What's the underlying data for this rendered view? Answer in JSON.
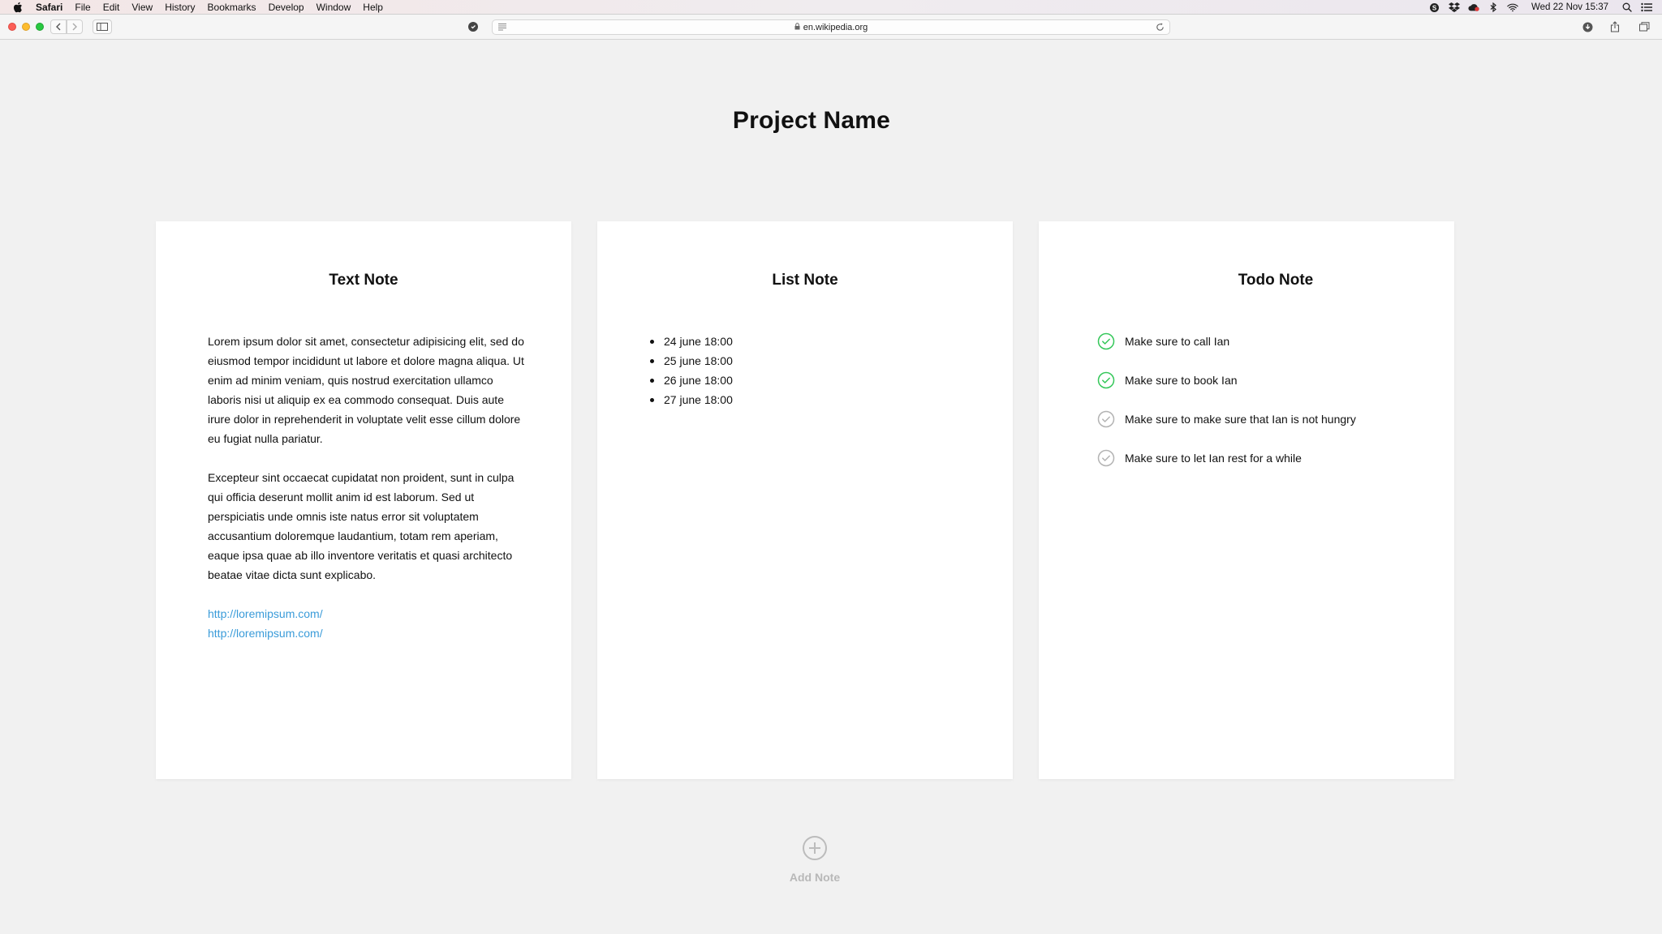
{
  "menubar": {
    "app_name": "Safari",
    "items": [
      "File",
      "Edit",
      "View",
      "History",
      "Bookmarks",
      "Develop",
      "Window",
      "Help"
    ],
    "clock": "Wed 22 Nov  15:37"
  },
  "browser": {
    "url": "en.wikipedia.org"
  },
  "page": {
    "title": "Project Name",
    "add_note_label": "Add Note"
  },
  "text_note": {
    "title": "Text Note",
    "paragraphs": [
      "Lorem ipsum dolor sit amet, consectetur adipisicing elit, sed do eiusmod tempor incididunt ut labore et dolore magna aliqua. Ut enim ad minim veniam, quis nostrud exercitation ullamco laboris nisi ut aliquip ex ea commodo consequat. Duis aute irure dolor in reprehenderit in voluptate velit esse cillum dolore eu fugiat nulla pariatur.",
      "Excepteur sint occaecat cupidatat non proident, sunt in culpa qui officia deserunt mollit anim id est laborum. Sed ut perspiciatis unde omnis iste natus error sit voluptatem accusantium doloremque laudantium, totam rem aperiam, eaque ipsa quae ab illo inventore veritatis et quasi architecto beatae vitae dicta sunt explicabo."
    ],
    "links": [
      "http://loremipsum.com/",
      "http://loremipsum.com/"
    ]
  },
  "list_note": {
    "title": "List Note",
    "items": [
      "24 june 18:00",
      "25 june 18:00",
      "26 june 18:00",
      "27 june 18:00"
    ]
  },
  "todo_note": {
    "title": "Todo Note",
    "items": [
      {
        "label": "Make sure to call Ian",
        "done": true
      },
      {
        "label": "Make sure to book Ian",
        "done": true
      },
      {
        "label": "Make sure to make sure that Ian is not hungry",
        "done": false
      },
      {
        "label": "Make sure to let Ian rest for a while",
        "done": false
      }
    ]
  },
  "colors": {
    "done_check": "#34c759",
    "pending_check": "#b3b3b3",
    "link": "#3a9bd9",
    "add_note": "#b8b8b8"
  }
}
